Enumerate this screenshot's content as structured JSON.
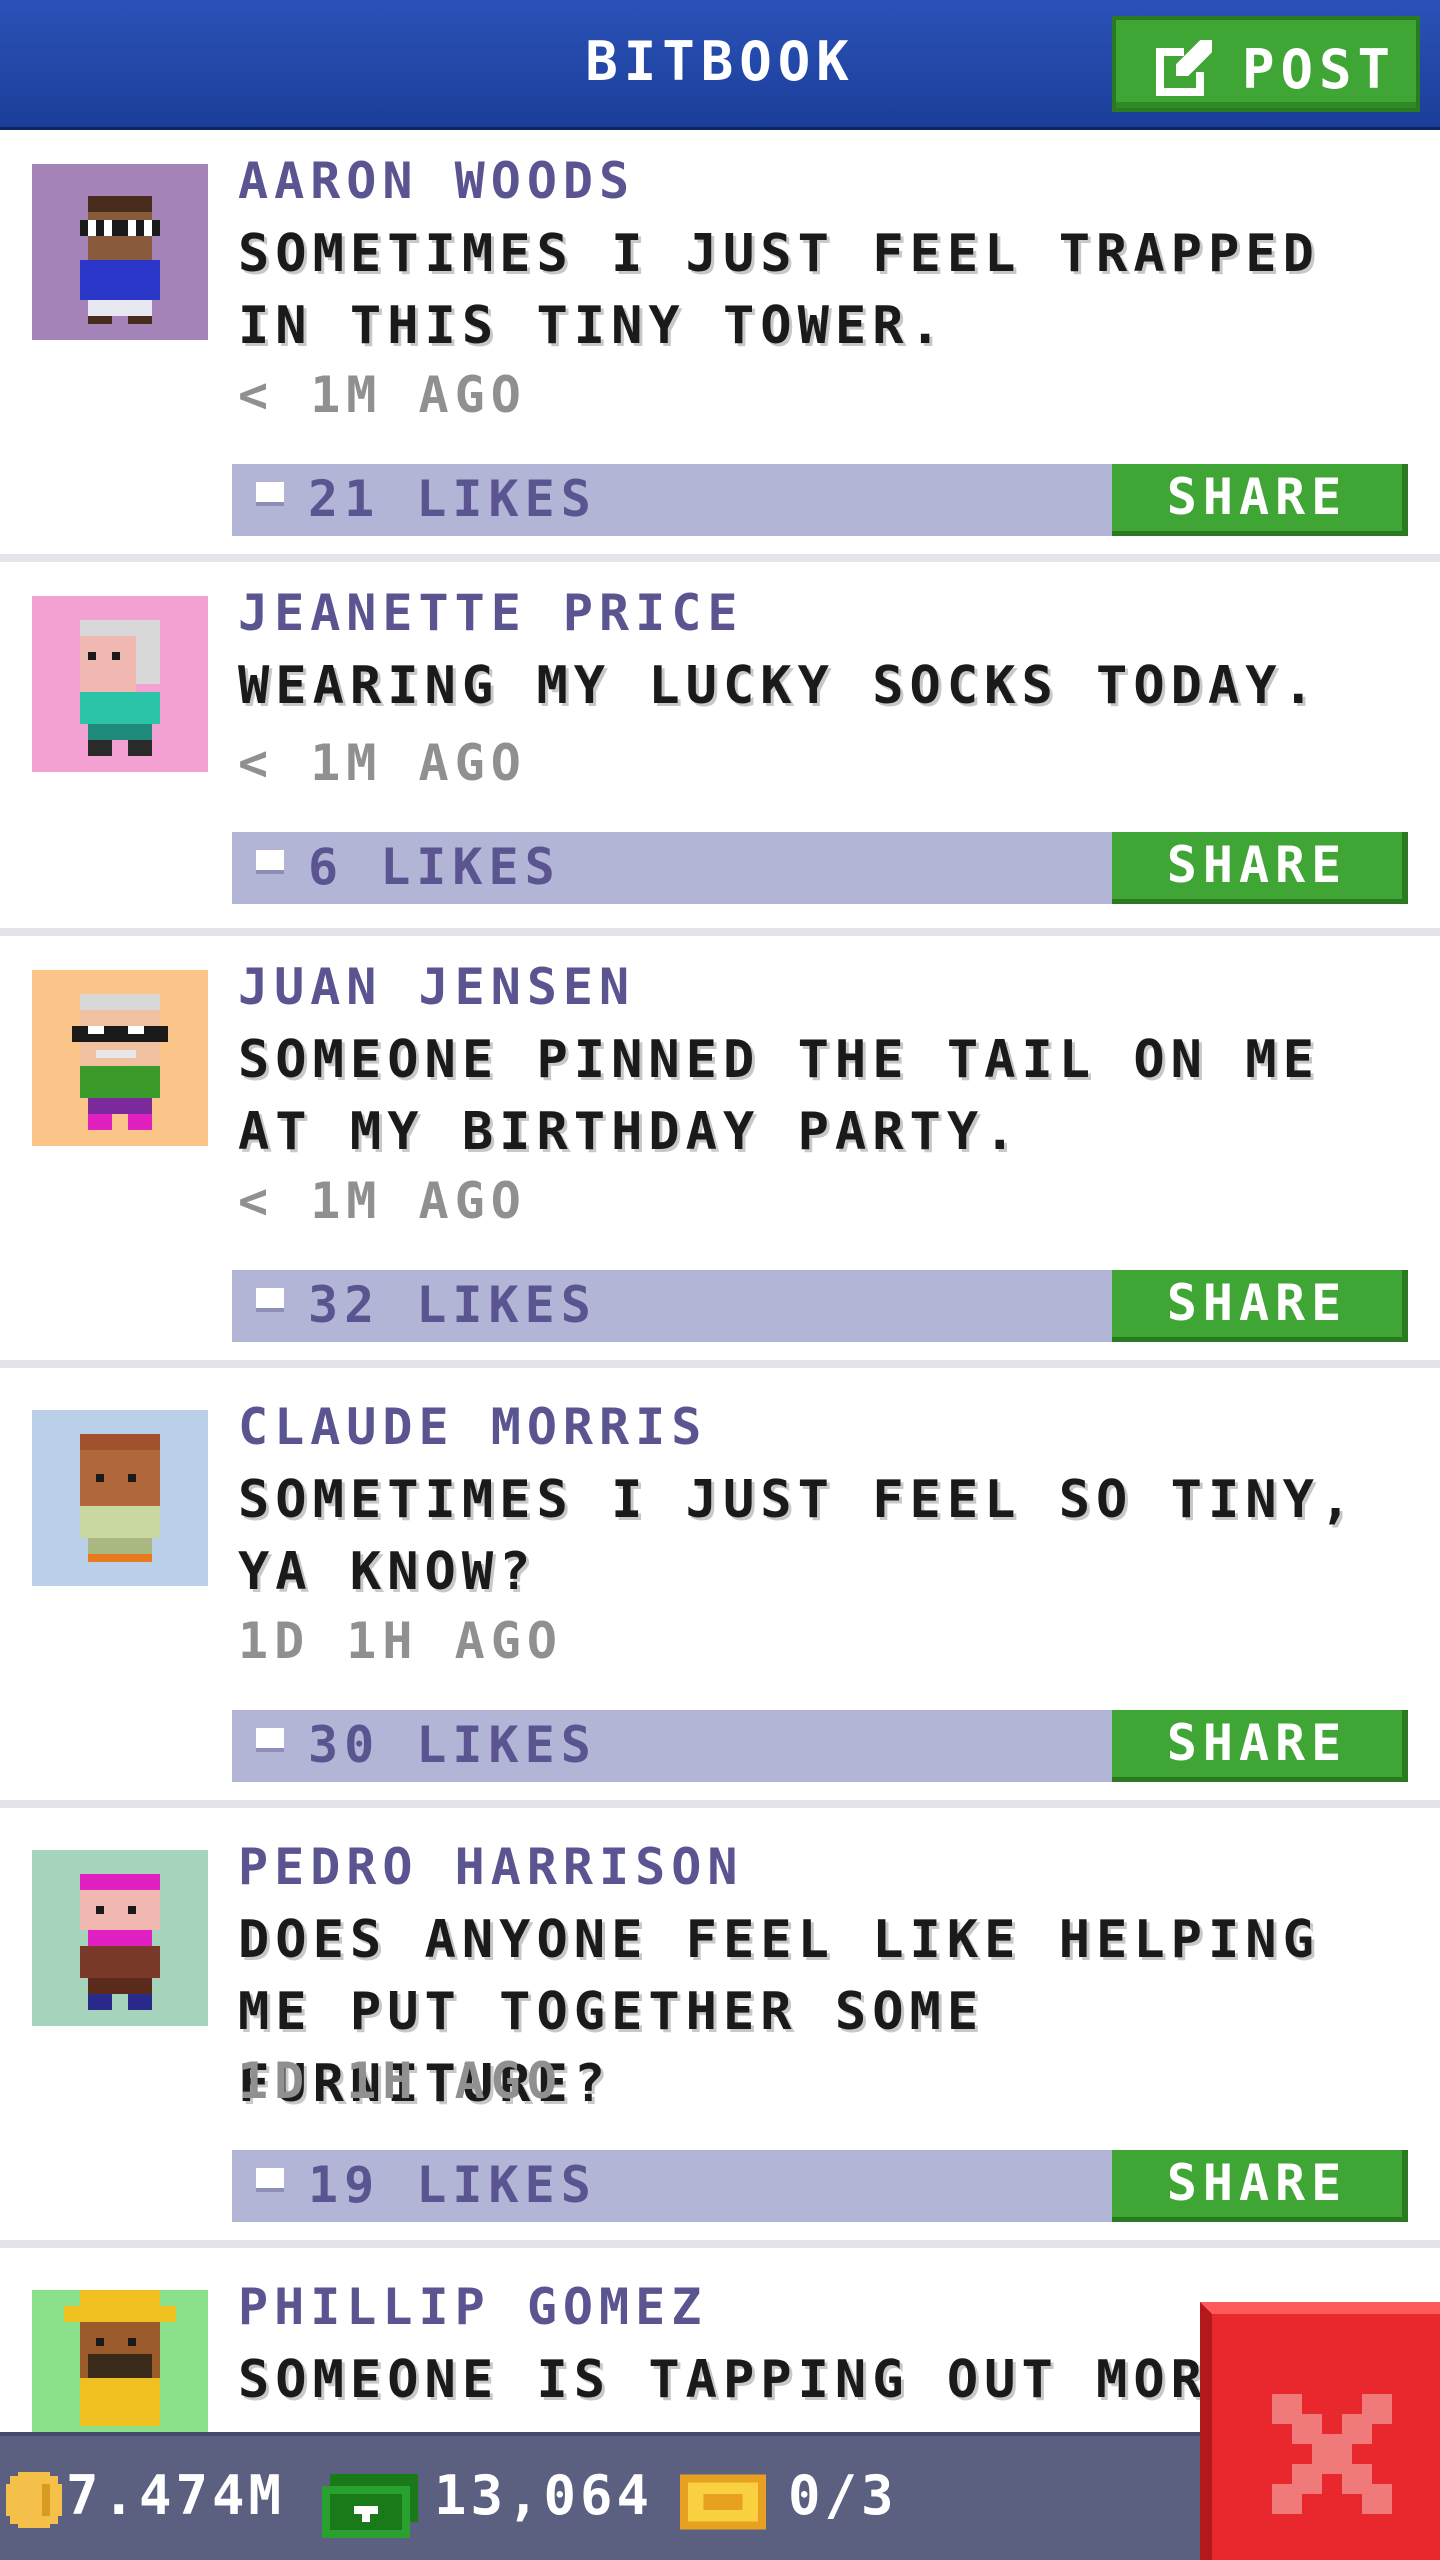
{
  "app": {
    "title": "BITBOOK",
    "post_label": "POST"
  },
  "posts": [
    {
      "name": "AARON WOODS",
      "message": "SOMETIMES I JUST FEEL TRAPPED IN THIS TINY TOWER.",
      "time": "< 1M AGO",
      "likes": "21 LIKES",
      "share_label": "SHARE",
      "avatar_bg": "#a383b8"
    },
    {
      "name": "JEANETTE PRICE",
      "message": "WEARING MY LUCKY SOCKS TODAY.",
      "time": "< 1M AGO",
      "likes": "6 LIKES",
      "share_label": "SHARE",
      "avatar_bg": "#f3a1d3"
    },
    {
      "name": "JUAN JENSEN",
      "message": "SOMEONE PINNED THE TAIL ON ME AT MY BIRTHDAY PARTY.",
      "time": "< 1M AGO",
      "likes": "32 LIKES",
      "share_label": "SHARE",
      "avatar_bg": "#fbc58a"
    },
    {
      "name": "CLAUDE MORRIS",
      "message": "SOMETIMES I JUST FEEL SO TINY, YA KNOW?",
      "time": "1D 1H AGO",
      "likes": "30 LIKES",
      "share_label": "SHARE",
      "avatar_bg": "#b9d0e8"
    },
    {
      "name": "PEDRO HARRISON",
      "message": "DOES ANYONE FEEL LIKE HELPING ME PUT TOGETHER SOME FURNITURE?",
      "time": "1D 1H AGO",
      "likes": "19 LIKES",
      "share_label": "SHARE",
      "avatar_bg": "#a6d3bb"
    },
    {
      "name": "PHILLIP GOMEZ",
      "message": "SOMEONE IS TAPPING OUT MORS",
      "avatar_bg": "#8be08a"
    }
  ],
  "status": {
    "coins": "7.474M",
    "bux": "13,064",
    "tickets": "0/3"
  },
  "colors": {
    "accent": "#3fa535",
    "header": "#2148a8",
    "close": "#e8282c"
  },
  "icons": {
    "post": "edit-icon",
    "like": "thumbs-up-icon",
    "coin": "coin-icon",
    "bux": "bux-icon",
    "ticket": "ticket-icon",
    "close": "close-icon"
  }
}
